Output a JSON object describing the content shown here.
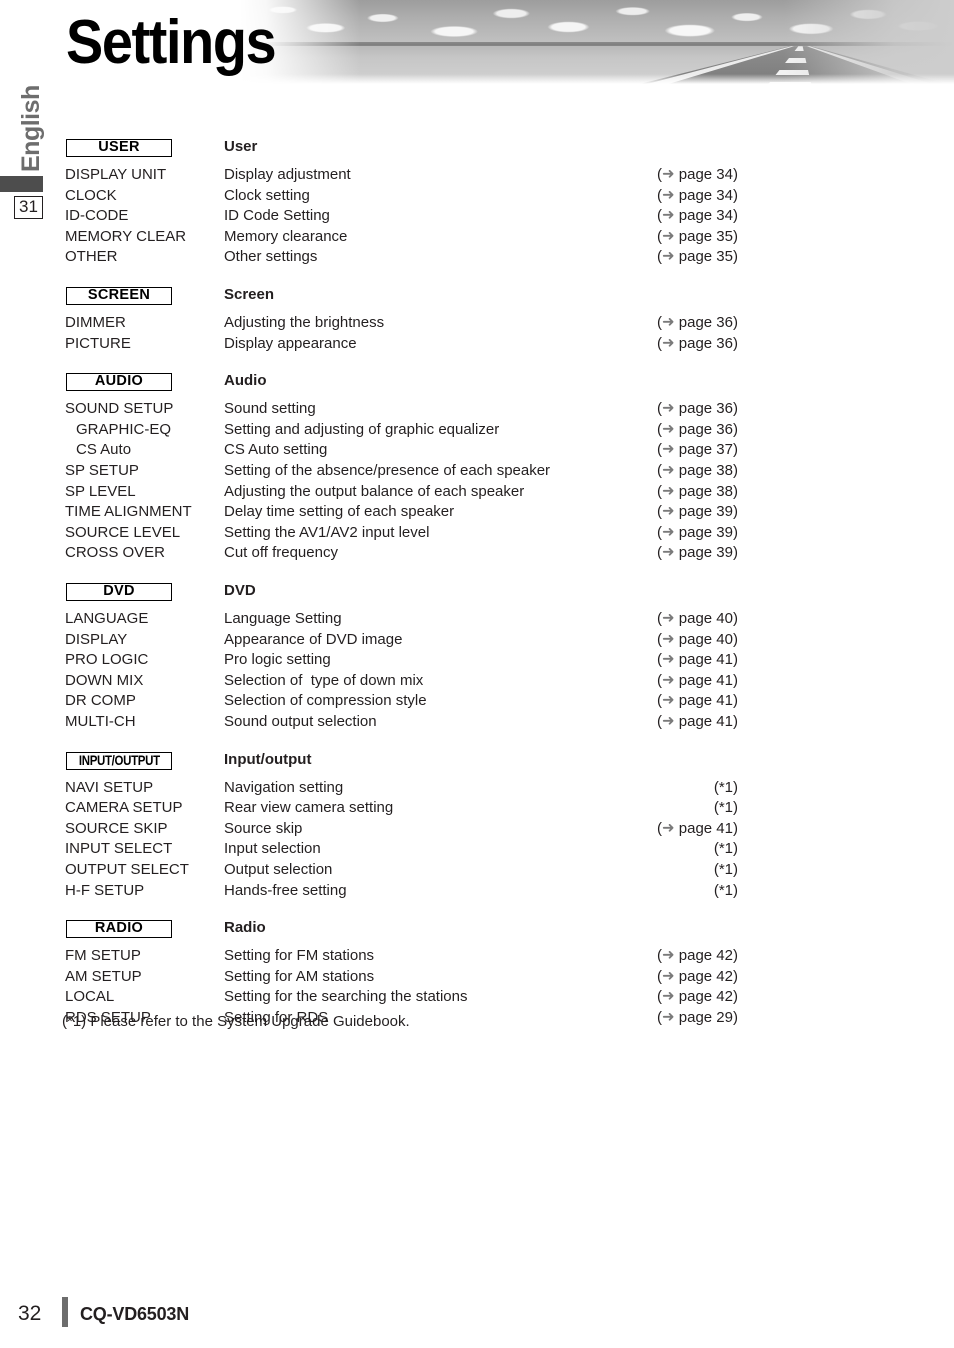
{
  "header": {
    "title": "Settings",
    "banner_icon": "desert-highway-photo"
  },
  "sidebar": {
    "language": "English",
    "chapter_number": "31"
  },
  "footer": {
    "page_number": "32",
    "model": "CQ-VD6503N"
  },
  "footnote": "(*1) Please refer to the System Upgrade Guidebook.",
  "arrow_glyph": "➜",
  "colors": {
    "text": "#231f20",
    "arrow_gray": "#7a7a7a",
    "sidebar_gray": "#6d6d6d",
    "bar_dark": "#4d4d4d"
  },
  "sections": [
    {
      "badge": "USER",
      "badge_style": "normal",
      "title": "User",
      "rows": [
        {
          "item": "DISPLAY UNIT",
          "indent": false,
          "desc": "Display adjustment",
          "ref": "page 34",
          "has_arrow": true
        },
        {
          "item": "CLOCK",
          "indent": false,
          "desc": "Clock setting",
          "ref": "page 34",
          "has_arrow": true
        },
        {
          "item": "ID-CODE",
          "indent": false,
          "desc": "ID Code Setting",
          "ref": "page 34",
          "has_arrow": true
        },
        {
          "item": "MEMORY CLEAR",
          "indent": false,
          "desc": "Memory clearance",
          "ref": "page 35",
          "has_arrow": true
        },
        {
          "item": "OTHER",
          "indent": false,
          "desc": "Other settings",
          "ref": "page 35",
          "has_arrow": true
        }
      ]
    },
    {
      "badge": "SCREEN",
      "badge_style": "normal",
      "title": "Screen",
      "rows": [
        {
          "item": "DIMMER",
          "indent": false,
          "desc": "Adjusting the brightness",
          "ref": "page 36",
          "has_arrow": true
        },
        {
          "item": "PICTURE",
          "indent": false,
          "desc": "Display appearance",
          "ref": "page 36",
          "has_arrow": true
        }
      ]
    },
    {
      "badge": "AUDIO",
      "badge_style": "normal",
      "title": "Audio",
      "rows": [
        {
          "item": "SOUND SETUP",
          "indent": false,
          "desc": "Sound setting",
          "ref": "page 36",
          "has_arrow": true
        },
        {
          "item": "GRAPHIC-EQ",
          "indent": true,
          "desc": "Setting and adjusting of graphic equalizer",
          "ref": "page 36",
          "has_arrow": true
        },
        {
          "item": "CS Auto",
          "indent": true,
          "desc": "CS Auto setting",
          "ref": "page 37",
          "has_arrow": true
        },
        {
          "item": "SP SETUP",
          "indent": false,
          "desc": "Setting of the absence/presence of each speaker",
          "ref": "page 38",
          "has_arrow": true
        },
        {
          "item": "SP LEVEL",
          "indent": false,
          "desc": "Adjusting the output balance of each speaker",
          "ref": "page 38",
          "has_arrow": true
        },
        {
          "item": "TIME ALIGNMENT",
          "indent": false,
          "desc": "Delay time setting of each speaker",
          "ref": "page 39",
          "has_arrow": true
        },
        {
          "item": "SOURCE LEVEL",
          "indent": false,
          "desc": "Setting the AV1/AV2 input level",
          "ref": "page 39",
          "has_arrow": true
        },
        {
          "item": "CROSS OVER",
          "indent": false,
          "desc": "Cut off frequency",
          "ref": "page 39",
          "has_arrow": true
        }
      ]
    },
    {
      "badge": "DVD",
      "badge_style": "normal",
      "title": "DVD",
      "rows": [
        {
          "item": "LANGUAGE",
          "indent": false,
          "desc": "Language Setting",
          "ref": "page 40",
          "has_arrow": true
        },
        {
          "item": "DISPLAY",
          "indent": false,
          "desc": "Appearance of DVD image",
          "ref": "page 40",
          "has_arrow": true
        },
        {
          "item": "PRO LOGIC",
          "indent": false,
          "desc": "Pro logic setting",
          "ref": "page 41",
          "has_arrow": true
        },
        {
          "item": "DOWN MIX",
          "indent": false,
          "desc": "Selection of  type of down mix",
          "ref": "page 41",
          "has_arrow": true
        },
        {
          "item": "DR COMP",
          "indent": false,
          "desc": "Selection of compression style",
          "ref": "page 41",
          "has_arrow": true
        },
        {
          "item": "MULTI-CH",
          "indent": false,
          "desc": "Sound output selection",
          "ref": "page 41",
          "has_arrow": true
        }
      ]
    },
    {
      "badge": "INPUT/OUTPUT",
      "badge_style": "condensed",
      "title": "Input/output",
      "rows": [
        {
          "item": "NAVI SETUP",
          "indent": false,
          "desc": "Navigation setting",
          "ref": "(*1)",
          "has_arrow": false
        },
        {
          "item": "CAMERA SETUP",
          "indent": false,
          "desc": "Rear view camera setting",
          "ref": "(*1)",
          "has_arrow": false
        },
        {
          "item": "SOURCE SKIP",
          "indent": false,
          "desc": "Source skip",
          "ref": "page 41",
          "has_arrow": true
        },
        {
          "item": "INPUT SELECT",
          "indent": false,
          "desc": "Input selection",
          "ref": "(*1)",
          "has_arrow": false
        },
        {
          "item": "OUTPUT SELECT",
          "indent": false,
          "desc": "Output selection",
          "ref": "(*1)",
          "has_arrow": false
        },
        {
          "item": "H-F SETUP",
          "indent": false,
          "desc": "Hands-free setting",
          "ref": "(*1)",
          "has_arrow": false
        }
      ]
    },
    {
      "badge": "RADIO",
      "badge_style": "normal",
      "title": "Radio",
      "rows": [
        {
          "item": "FM SETUP",
          "indent": false,
          "desc": "Setting for FM stations",
          "ref": "page 42",
          "has_arrow": true
        },
        {
          "item": "AM SETUP",
          "indent": false,
          "desc": "Setting for AM stations",
          "ref": "page 42",
          "has_arrow": true
        },
        {
          "item": "LOCAL",
          "indent": false,
          "desc": "Setting for the searching the stations",
          "ref": "page 42",
          "has_arrow": true
        },
        {
          "item": "RDS SETUP",
          "indent": false,
          "desc": "Setting for RDS",
          "ref": "page 29",
          "has_arrow": true
        }
      ]
    }
  ]
}
